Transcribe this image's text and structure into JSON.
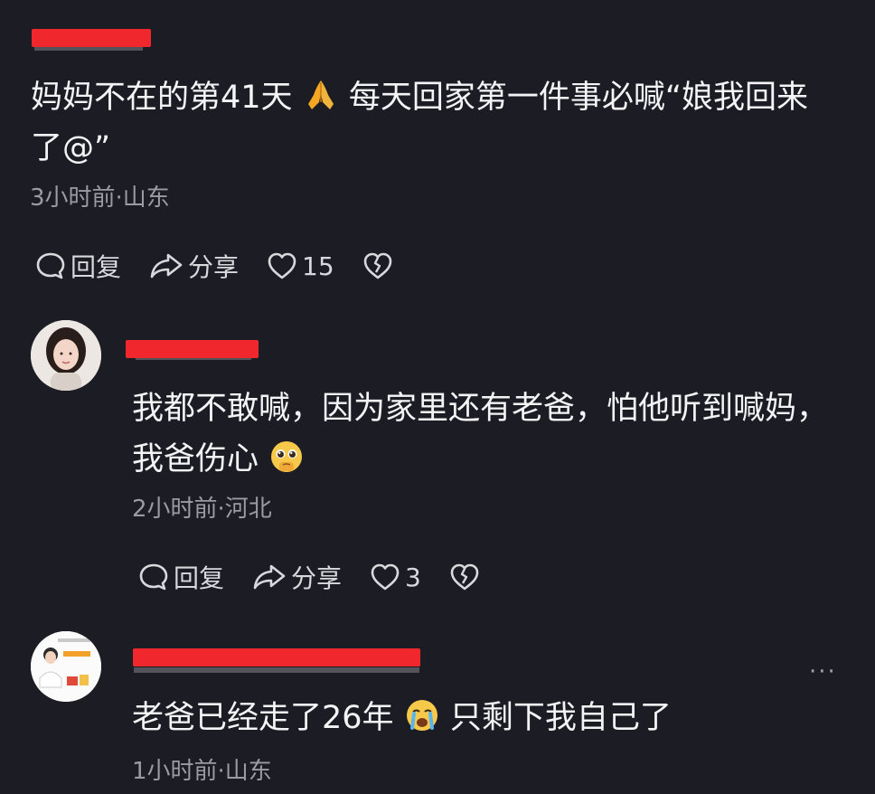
{
  "comments": [
    {
      "line1": "妈妈不在的第41天",
      "line1b": "每天回家第一件事必喊“娘我回来",
      "line2": "了@”",
      "meta": "3小时前·山东",
      "reply_label": "回复",
      "share_label": "分享",
      "likes": "15"
    },
    {
      "line1": "我都不敢喊，因为家里还有老爸，怕他听到喊妈，",
      "line2": "我爸伤心",
      "meta": "2小时前·河北",
      "reply_label": "回复",
      "share_label": "分享",
      "likes": "3"
    },
    {
      "line1": "老爸已经走了26年",
      "line1b": "只剩下我自己了",
      "meta": "1小时前·山东",
      "more": "···"
    }
  ],
  "icons": {
    "comment1_emoji": "folded-hands-icon",
    "comment2_emoji": "pleading-face-icon",
    "comment3_emoji": "crying-face-icon"
  },
  "colors": {
    "background": "#1c1c24",
    "redaction": "#f0282d",
    "meta_text": "#9b9ba4"
  }
}
